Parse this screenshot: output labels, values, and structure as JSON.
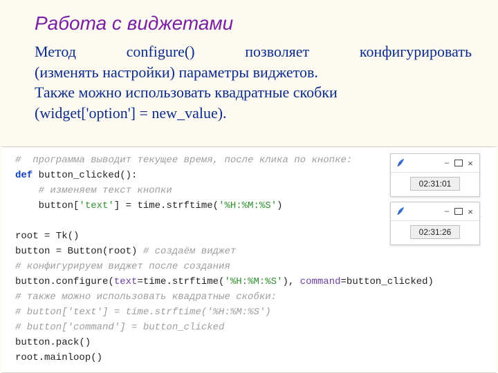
{
  "title": "Работа с виджетами",
  "desc": {
    "line1_a": "Метод",
    "line1_b": "configure()",
    "line1_c": "позволяет",
    "line1_d": "конфигурировать",
    "line2": "(изменять настройки) параметры виджетов.",
    "line3": "Также можно использовать квадратные скобки",
    "line4": "(widget['option'] = new_value)."
  },
  "code": {
    "l1_com": "#  программа выводит текущее время, после клика по кнопке:",
    "l2_kw": "def",
    "l2_name": " button_clicked():",
    "l3_com": "    # изменяем текст кнопки",
    "l4_pre": "    button[",
    "l4_key": "'text'",
    "l4_mid": "] = time.strftime(",
    "l4_fmt": "'%H:%M:%S'",
    "l4_post": ")",
    "blank": "",
    "l6": "root = Tk()",
    "l7_pre": "button = Button(root) ",
    "l7_com": "# создаём виджет",
    "l8_com": "# конфигурируем виджет после создания",
    "l9_pre": "button.configure(",
    "l9_arg1": "text",
    "l9_eq1": "=time.strftime(",
    "l9_fmt": "'%H:%M:%S'",
    "l9_mid": "), ",
    "l9_arg2": "command",
    "l9_post": "=button_clicked)",
    "l10_com": "# также можно использовать квадратные скобки:",
    "l11_com": "# button['text'] = time.strftime('%H:%M:%S')",
    "l12_com": "# button['command'] = button_clicked",
    "l13": "button.pack()",
    "l14": "root.mainloop()"
  },
  "windows": {
    "w1_time": "02:31:01",
    "w2_time": "02:31:26",
    "min": "–",
    "close": "×"
  }
}
